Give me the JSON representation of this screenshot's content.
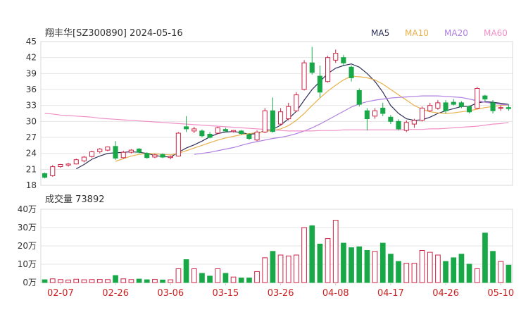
{
  "header": {
    "title": "翔丰华[SZ300890] 2024-05-16",
    "volume_label": "成交量 73892"
  },
  "legend": [
    {
      "name": "MA5",
      "color": "#2e2e5a"
    },
    {
      "name": "MA10",
      "color": "#e8b04a"
    },
    {
      "name": "MA20",
      "color": "#b07fe0"
    },
    {
      "name": "MA60",
      "color": "#f090c8"
    }
  ],
  "colors": {
    "up": "#cc2244",
    "down": "#18a848",
    "axis_date": "#cc2222"
  },
  "chart_data": [
    {
      "type": "candlestick",
      "title": "翔丰华[SZ300890] 2024-05-16",
      "ylim": [
        18,
        45
      ],
      "y_ticks": [
        18,
        21,
        24,
        27,
        30,
        33,
        36,
        39,
        42,
        45
      ],
      "x_tick_labels": [
        "02-07",
        "02-26",
        "03-06",
        "03-15",
        "03-26",
        "04-08",
        "04-17",
        "04-26",
        "05-10"
      ],
      "candles": [
        {
          "date": "02-05",
          "o": 20.2,
          "h": 20.4,
          "l": 19.3,
          "c": 19.5,
          "up": false
        },
        {
          "date": "02-06",
          "o": 19.8,
          "h": 21.8,
          "l": 19.6,
          "c": 21.5,
          "up": true
        },
        {
          "date": "02-07",
          "o": 21.5,
          "h": 22.0,
          "l": 21.3,
          "c": 21.9,
          "up": true
        },
        {
          "date": "02-08",
          "o": 21.8,
          "h": 22.2,
          "l": 21.5,
          "c": 22.0,
          "up": true
        },
        {
          "date": "02-19",
          "o": 22.0,
          "h": 23.0,
          "l": 21.9,
          "c": 22.8,
          "up": true
        },
        {
          "date": "02-20",
          "o": 22.6,
          "h": 23.5,
          "l": 22.3,
          "c": 23.3,
          "up": true
        },
        {
          "date": "02-21",
          "o": 23.4,
          "h": 24.5,
          "l": 23.2,
          "c": 24.3,
          "up": true
        },
        {
          "date": "02-22",
          "o": 24.3,
          "h": 25.0,
          "l": 24.0,
          "c": 24.8,
          "up": true
        },
        {
          "date": "02-23",
          "o": 24.6,
          "h": 25.3,
          "l": 24.4,
          "c": 25.2,
          "up": true
        },
        {
          "date": "02-26",
          "o": 25.3,
          "h": 26.3,
          "l": 22.8,
          "c": 23.1,
          "up": false
        },
        {
          "date": "02-27",
          "o": 23.2,
          "h": 24.5,
          "l": 23.0,
          "c": 24.2,
          "up": true
        },
        {
          "date": "02-28",
          "o": 24.2,
          "h": 24.8,
          "l": 24.0,
          "c": 24.6,
          "up": true
        },
        {
          "date": "02-29",
          "o": 24.8,
          "h": 25.0,
          "l": 24.0,
          "c": 24.2,
          "up": false
        },
        {
          "date": "03-01",
          "o": 24.0,
          "h": 24.2,
          "l": 23.0,
          "c": 23.2,
          "up": false
        },
        {
          "date": "03-04",
          "o": 23.3,
          "h": 23.9,
          "l": 23.1,
          "c": 23.7,
          "up": true
        },
        {
          "date": "03-05",
          "o": 23.8,
          "h": 24.0,
          "l": 23.1,
          "c": 23.3,
          "up": false
        },
        {
          "date": "03-06",
          "o": 23.2,
          "h": 23.6,
          "l": 22.9,
          "c": 23.4,
          "up": true
        },
        {
          "date": "03-07",
          "o": 23.5,
          "h": 28.0,
          "l": 23.4,
          "c": 27.8,
          "up": true
        },
        {
          "date": "03-08",
          "o": 29.0,
          "h": 31.0,
          "l": 28.0,
          "c": 28.6,
          "up": false
        },
        {
          "date": "03-11",
          "o": 28.2,
          "h": 29.0,
          "l": 27.8,
          "c": 28.6,
          "up": true
        },
        {
          "date": "03-12",
          "o": 28.2,
          "h": 28.5,
          "l": 27.0,
          "c": 27.3,
          "up": false
        },
        {
          "date": "03-13",
          "o": 27.6,
          "h": 28.0,
          "l": 26.8,
          "c": 27.0,
          "up": false
        },
        {
          "date": "03-14",
          "o": 27.8,
          "h": 29.0,
          "l": 27.6,
          "c": 28.8,
          "up": true
        },
        {
          "date": "03-15",
          "o": 28.5,
          "h": 28.8,
          "l": 28.0,
          "c": 28.2,
          "up": false
        },
        {
          "date": "03-18",
          "o": 28.1,
          "h": 28.4,
          "l": 27.9,
          "c": 28.3,
          "up": true
        },
        {
          "date": "03-19",
          "o": 28.2,
          "h": 28.4,
          "l": 27.5,
          "c": 27.7,
          "up": false
        },
        {
          "date": "03-20",
          "o": 27.5,
          "h": 27.8,
          "l": 26.5,
          "c": 26.8,
          "up": false
        },
        {
          "date": "03-21",
          "o": 26.5,
          "h": 28.3,
          "l": 26.3,
          "c": 28.0,
          "up": true
        },
        {
          "date": "03-22",
          "o": 28.0,
          "h": 32.5,
          "l": 27.8,
          "c": 32.0,
          "up": true
        },
        {
          "date": "03-25",
          "o": 32.0,
          "h": 34.5,
          "l": 27.9,
          "c": 28.1,
          "up": false
        },
        {
          "date": "03-26",
          "o": 29.5,
          "h": 32.5,
          "l": 29.2,
          "c": 31.8,
          "up": true
        },
        {
          "date": "03-27",
          "o": 30.5,
          "h": 33.5,
          "l": 30.2,
          "c": 32.8,
          "up": true
        },
        {
          "date": "03-28",
          "o": 32.0,
          "h": 35.5,
          "l": 31.8,
          "c": 35.0,
          "up": true
        },
        {
          "date": "03-29",
          "o": 36.0,
          "h": 41.5,
          "l": 35.8,
          "c": 41.0,
          "up": true
        },
        {
          "date": "04-01",
          "o": 41.0,
          "h": 44.0,
          "l": 38.8,
          "c": 39.2,
          "up": false
        },
        {
          "date": "04-02",
          "o": 38.5,
          "h": 40.5,
          "l": 34.5,
          "c": 35.5,
          "up": false
        },
        {
          "date": "04-03",
          "o": 37.5,
          "h": 42.3,
          "l": 37.3,
          "c": 42.0,
          "up": true
        },
        {
          "date": "04-08",
          "o": 41.5,
          "h": 43.5,
          "l": 41.0,
          "c": 42.8,
          "up": true
        },
        {
          "date": "04-09",
          "o": 42.0,
          "h": 42.5,
          "l": 40.5,
          "c": 41.0,
          "up": false
        },
        {
          "date": "04-10",
          "o": 40.2,
          "h": 40.5,
          "l": 37.5,
          "c": 38.2,
          "up": false
        },
        {
          "date": "04-11",
          "o": 35.8,
          "h": 36.2,
          "l": 32.8,
          "c": 33.2,
          "up": false
        },
        {
          "date": "04-12",
          "o": 32.0,
          "h": 32.5,
          "l": 28.3,
          "c": 30.5,
          "up": false
        },
        {
          "date": "04-15",
          "o": 31.0,
          "h": 32.5,
          "l": 30.5,
          "c": 32.0,
          "up": true
        },
        {
          "date": "04-16",
          "o": 32.5,
          "h": 33.5,
          "l": 31.0,
          "c": 31.5,
          "up": false
        },
        {
          "date": "04-17",
          "o": 30.8,
          "h": 31.2,
          "l": 29.5,
          "c": 30.0,
          "up": false
        },
        {
          "date": "04-18",
          "o": 30.0,
          "h": 30.4,
          "l": 28.3,
          "c": 28.6,
          "up": false
        },
        {
          "date": "04-19",
          "o": 28.3,
          "h": 30.2,
          "l": 28.0,
          "c": 29.8,
          "up": true
        },
        {
          "date": "04-22",
          "o": 29.5,
          "h": 30.5,
          "l": 28.8,
          "c": 30.2,
          "up": true
        },
        {
          "date": "04-23",
          "o": 30.2,
          "h": 32.8,
          "l": 30.0,
          "c": 32.5,
          "up": true
        },
        {
          "date": "04-24",
          "o": 32.0,
          "h": 33.5,
          "l": 31.8,
          "c": 33.0,
          "up": true
        },
        {
          "date": "04-25",
          "o": 32.5,
          "h": 34.0,
          "l": 32.2,
          "c": 33.5,
          "up": true
        },
        {
          "date": "04-26",
          "o": 33.5,
          "h": 34.0,
          "l": 31.5,
          "c": 32.0,
          "up": false
        },
        {
          "date": "04-29",
          "o": 33.6,
          "h": 34.2,
          "l": 33.0,
          "c": 33.2,
          "up": false
        },
        {
          "date": "04-30",
          "o": 33.5,
          "h": 33.8,
          "l": 32.5,
          "c": 32.8,
          "up": false
        },
        {
          "date": "05-06",
          "o": 32.8,
          "h": 33.0,
          "l": 31.5,
          "c": 31.8,
          "up": false
        },
        {
          "date": "05-07",
          "o": 32.5,
          "h": 36.5,
          "l": 32.4,
          "c": 36.2,
          "up": true
        },
        {
          "date": "05-08",
          "o": 34.8,
          "h": 35.0,
          "l": 33.8,
          "c": 34.2,
          "up": false
        },
        {
          "date": "05-09",
          "o": 33.5,
          "h": 34.0,
          "l": 31.5,
          "c": 32.0,
          "up": false
        },
        {
          "date": "05-10",
          "o": 32.5,
          "h": 33.0,
          "l": 32.0,
          "c": 32.6,
          "up": true
        },
        {
          "date": "05-13",
          "o": 32.6,
          "h": 33.2,
          "l": 32.0,
          "c": 32.4,
          "up": false
        }
      ],
      "ma_series": [
        {
          "name": "MA5",
          "color": "#2e2e5a",
          "values": [
            null,
            null,
            null,
            null,
            21.1,
            21.9,
            22.9,
            23.5,
            24.0,
            24.1,
            24.2,
            24.3,
            24.2,
            24.0,
            23.6,
            23.4,
            23.3,
            24.2,
            25.0,
            25.6,
            26.3,
            27.1,
            27.7,
            28.0,
            28.1,
            27.9,
            27.6,
            27.7,
            28.3,
            28.5,
            29.3,
            30.5,
            31.9,
            34.0,
            36.0,
            37.5,
            39.0,
            40.0,
            40.5,
            40.8,
            40.2,
            39.0,
            37.5,
            35.5,
            33.0,
            31.5,
            30.5,
            30.2,
            30.3,
            30.8,
            31.5,
            32.0,
            32.4,
            32.8,
            32.8,
            33.5,
            33.7,
            33.6,
            33.4,
            33.2
          ]
        },
        {
          "name": "MA10",
          "color": "#e8b04a",
          "values": [
            null,
            null,
            null,
            null,
            null,
            null,
            null,
            null,
            null,
            22.5,
            23.0,
            23.5,
            23.8,
            24.0,
            23.9,
            23.8,
            23.7,
            24.0,
            24.5,
            25.0,
            25.5,
            26.0,
            26.5,
            26.9,
            27.2,
            27.5,
            27.7,
            27.9,
            28.1,
            28.3,
            28.6,
            29.2,
            30.2,
            31.5,
            33.0,
            34.4,
            35.7,
            36.8,
            37.8,
            38.5,
            38.4,
            38.2,
            37.8,
            37.0,
            36.0,
            35.0,
            34.0,
            33.0,
            32.3,
            31.8,
            31.6,
            31.5,
            31.6,
            31.8,
            32.0,
            32.3,
            32.6,
            32.8,
            33.0,
            33.1
          ]
        },
        {
          "name": "MA20",
          "color": "#b07fe0",
          "values": [
            null,
            null,
            null,
            null,
            null,
            null,
            null,
            null,
            null,
            null,
            null,
            null,
            null,
            null,
            null,
            null,
            null,
            null,
            null,
            23.8,
            24.0,
            24.2,
            24.5,
            24.8,
            25.1,
            25.5,
            25.9,
            26.2,
            26.5,
            26.8,
            27.0,
            27.3,
            27.7,
            28.2,
            28.8,
            29.5,
            30.3,
            31.1,
            31.9,
            32.7,
            33.3,
            33.7,
            34.0,
            34.2,
            34.4,
            34.5,
            34.6,
            34.7,
            34.8,
            34.8,
            34.8,
            34.7,
            34.6,
            34.5,
            34.2,
            33.9,
            33.6,
            33.4,
            33.2,
            33.1
          ]
        },
        {
          "name": "MA60",
          "color": "#f090c8",
          "values": [
            31.5,
            31.4,
            31.2,
            31.1,
            31.0,
            30.9,
            30.8,
            30.6,
            30.5,
            30.4,
            30.3,
            30.2,
            30.1,
            30.0,
            29.9,
            29.8,
            29.7,
            29.6,
            29.5,
            29.4,
            29.3,
            29.2,
            29.1,
            29.0,
            28.9,
            28.8,
            28.7,
            28.6,
            28.5,
            28.4,
            28.3,
            28.2,
            28.2,
            28.2,
            28.2,
            28.3,
            28.3,
            28.3,
            28.4,
            28.4,
            28.4,
            28.4,
            28.4,
            28.4,
            28.4,
            28.4,
            28.5,
            28.5,
            28.5,
            28.6,
            28.6,
            28.7,
            28.8,
            28.9,
            29.0,
            29.1,
            29.3,
            29.5,
            29.6,
            29.8
          ]
        }
      ]
    },
    {
      "type": "bar",
      "title": "成交量 73892",
      "ylim": [
        0,
        40
      ],
      "y_tick_labels": [
        "0万",
        "10万",
        "20万",
        "30万",
        "40万"
      ],
      "values_wan": [
        1.5,
        2.0,
        1.6,
        1.4,
        1.8,
        1.5,
        1.6,
        1.7,
        1.6,
        3.8,
        2.0,
        1.6,
        1.9,
        1.5,
        1.7,
        1.4,
        1.5,
        7.5,
        12.5,
        7.5,
        5.0,
        3.5,
        7.5,
        5.0,
        3.0,
        2.5,
        2.5,
        6.0,
        13.5,
        17.0,
        15.0,
        14.5,
        15.0,
        30.0,
        31.0,
        21.0,
        24.0,
        34.0,
        21.5,
        19.0,
        19.5,
        17.5,
        17.0,
        21.5,
        15.5,
        11.5,
        10.5,
        10.5,
        17.5,
        16.5,
        15.0,
        11.5,
        13.5,
        15.5,
        10.0,
        7.5,
        27.0,
        17.0,
        11.5,
        9.5,
        7.4
      ]
    }
  ]
}
